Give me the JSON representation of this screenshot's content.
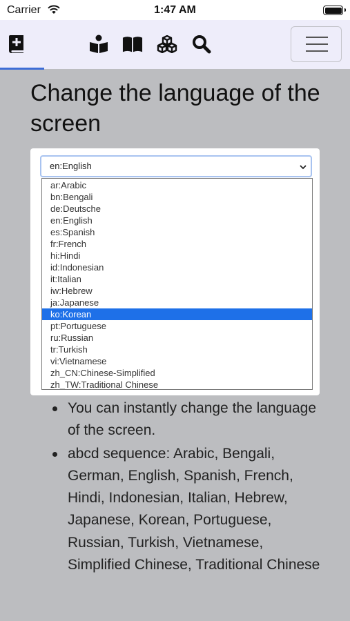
{
  "status_bar": {
    "carrier": "Carrier",
    "time": "1:47 AM"
  },
  "navbar": {
    "icons": [
      "bible-plus-icon",
      "reader-book-icon",
      "open-book-icon",
      "cubes-icon",
      "search-icon"
    ],
    "menu_icon": "hamburger-icon",
    "accent_color": "#3d6dd6"
  },
  "page": {
    "title": "Change the language of the screen"
  },
  "language_select": {
    "value": "en:English",
    "options": [
      "ar:Arabic",
      "bn:Bengali",
      "de:Deutsche",
      "en:English",
      "es:Spanish",
      "fr:French",
      "hi:Hindi",
      "id:Indonesian",
      "it:Italian",
      "iw:Hebrew",
      "ja:Japanese",
      "ko:Korean",
      "pt:Portuguese",
      "ru:Russian",
      "tr:Turkish",
      "vi:Vietnamese",
      "zh_CN:Chinese-Simplified",
      "zh_TW:Traditional Chinese"
    ],
    "highlighted": "ko:Korean"
  },
  "bullets": [
    "You can instantly change the language of the screen.",
    "abcd sequence: Arabic, Bengali, German, English, Spanish, French, Hindi, Indonesian, Italian, Hebrew, Japanese, Korean, Portuguese, Russian, Turkish, Vietnamese, Simplified Chinese, Traditional Chinese"
  ]
}
